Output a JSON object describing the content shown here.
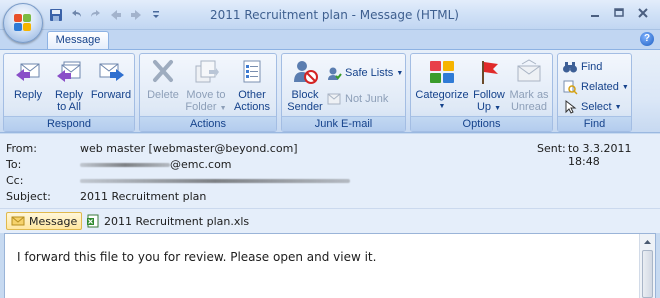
{
  "window": {
    "title": "2011 Recruitment plan - Message (HTML)"
  },
  "quick_access": {
    "icons": [
      "save-icon",
      "undo-icon",
      "redo-icon",
      "previous-item-icon",
      "next-item-icon",
      "customize-qat-icon"
    ]
  },
  "tabs": [
    {
      "label": "Message"
    }
  ],
  "ribbon": {
    "respond": {
      "label": "Respond",
      "reply": "Reply",
      "reply_all_line1": "Reply",
      "reply_all_line2": "to All",
      "forward": "Forward"
    },
    "actions": {
      "label": "Actions",
      "delete": "Delete",
      "move_line1": "Move to",
      "move_line2": "Folder",
      "other_line1": "Other",
      "other_line2": "Actions"
    },
    "junk": {
      "label": "Junk E-mail",
      "block_line1": "Block",
      "block_line2": "Sender",
      "safe_lists": "Safe Lists",
      "not_junk": "Not Junk"
    },
    "options": {
      "label": "Options",
      "categorize": "Categorize",
      "follow_line1": "Follow",
      "follow_line2": "Up",
      "mark_line1": "Mark as",
      "mark_line2": "Unread"
    },
    "find": {
      "label": "Find",
      "find": "Find",
      "related": "Related",
      "select": "Select"
    }
  },
  "header": {
    "from_label": "From:",
    "from_value": "web master [webmaster@beyond.com]",
    "to_label": "To:",
    "to_value": "@emc.com",
    "cc_label": "Cc:",
    "subject_label": "Subject:",
    "subject_value": "2011 Recruitment plan",
    "sent_label": "Sent:",
    "sent_value": "to 3.3.2011 18:48"
  },
  "attachments": {
    "message_tab": "Message",
    "file": "2011 Recruitment plan.xls"
  },
  "body": {
    "text": "I forward this file to you for review. Please open and view it."
  },
  "colors": {
    "ribbon_text": "#15428b",
    "accent_blue": "#1e5fc1"
  }
}
